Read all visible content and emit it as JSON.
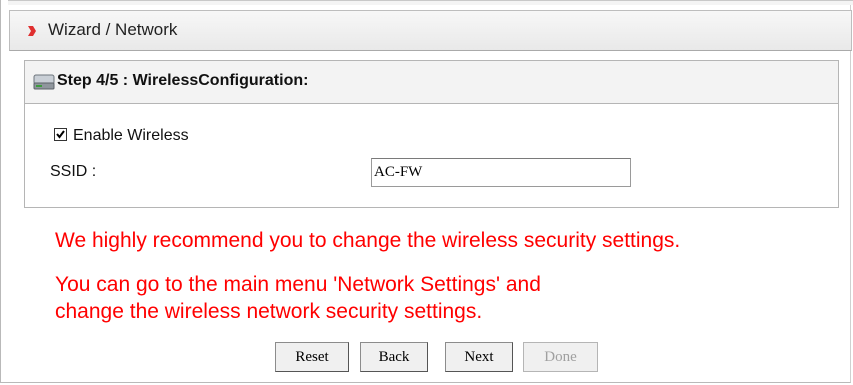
{
  "header": {
    "title": "Wizard / Network",
    "icon": "arrow-right-icon",
    "accent": "#e03030"
  },
  "panel": {
    "title": "Step 4/5 : WirelessConfiguration:",
    "icon": "drive-icon",
    "enable_wireless": {
      "label": "Enable Wireless",
      "checked": true
    },
    "ssid": {
      "label": "SSID :",
      "value": "AC-FW"
    }
  },
  "messages": {
    "line1": "We highly recommend you to change the wireless security settings.",
    "line2": "You can go to the main menu 'Network Settings' and",
    "line3": "change the wireless network security settings.",
    "color": "#ff0000"
  },
  "buttons": {
    "reset": "Reset",
    "back": "Back",
    "next": "Next",
    "done": "Done"
  }
}
